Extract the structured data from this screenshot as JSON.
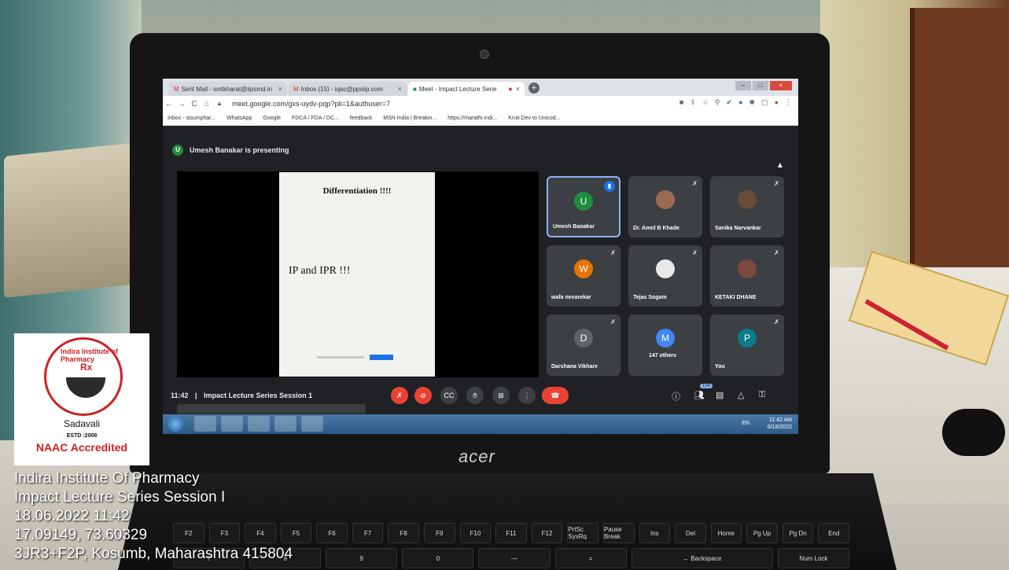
{
  "browser": {
    "tabs": [
      {
        "label": "Sent Mail - smtkharat@iipsmd.in"
      },
      {
        "label": "Inbox (15) - iqac@ppsiip.com"
      },
      {
        "label": "Meet - Impact Lecture Serie"
      }
    ],
    "url": "meet.google.com/gxs-uydv-pqp?pli=1&authuser=7",
    "bookmarks": [
      "Inbox - sisumphar...",
      "WhatsApp",
      "Google",
      "FDCA / FDA / DC...",
      "feedback",
      "MSN India | Breakin...",
      "https://marathi.indi...",
      "Kruti Dev to Unicod..."
    ]
  },
  "meet": {
    "presenting_avatar": "U",
    "presenting_text": "Umesh Banakar is presenting",
    "slide": {
      "title": "Differentiation !!!!",
      "body": "IP and IPR !!!"
    },
    "participants": [
      {
        "name": "Umesh Banakar",
        "initial": "U",
        "color": "#1e8e3e"
      },
      {
        "name": "Dr. Amol B Khade",
        "initial": "",
        "color": "#9b6a52"
      },
      {
        "name": "Sanika Narvankar",
        "initial": "",
        "color": "#6b4a3a"
      },
      {
        "name": "wafa nevarekar",
        "initial": "W",
        "color": "#e37400"
      },
      {
        "name": "Tejas Sogam",
        "initial": "",
        "color": "#e8e8e8"
      },
      {
        "name": "KETAKI DHANE",
        "initial": "",
        "color": "#7a4a3e"
      },
      {
        "name": "Darshana Vikhare",
        "initial": "D",
        "color": "#5f6368"
      },
      {
        "name": "147 others",
        "initial": "M",
        "color": "#4285f4"
      },
      {
        "name": "You",
        "initial": "P",
        "color": "#0b7c8a"
      }
    ],
    "time": "11:42",
    "meeting_title": "Impact Lecture Series Session 1",
    "people_count": "154"
  },
  "taskbar": {
    "lang": "EN",
    "clock_time": "11:42 AM",
    "clock_date": "6/18/2022"
  },
  "laptop": {
    "brand": "acer"
  },
  "keyboard": {
    "row1": [
      "F2",
      "F3",
      "F4",
      "F5",
      "F6",
      "F7",
      "F8",
      "F9",
      "F10",
      "F11",
      "F12",
      "PrtSc SysRq",
      "Pause Break",
      "Ins",
      "Del",
      "Home",
      "Pg Up",
      "Pg Dn",
      "End"
    ],
    "row2": [
      "7",
      "8",
      "9",
      "0",
      "—",
      "=",
      "← Backspace",
      "Num Lock"
    ]
  },
  "logo": {
    "arc_text": "Indira Institute of Pharmacy",
    "rx": "Rx",
    "place": "Sadavali",
    "estd": "ESTD :2008",
    "naac": "NAAC Accredited"
  },
  "overlay": {
    "line1": "Indira Institute Of Pharmacy",
    "line2": "Impact Lecture Series Session I",
    "line3": "18.06.2022 11:42",
    "line4": "17.09149, 73.60329",
    "line5": "3JR3+F2P, Kosumb, Maharashtra 415804"
  }
}
